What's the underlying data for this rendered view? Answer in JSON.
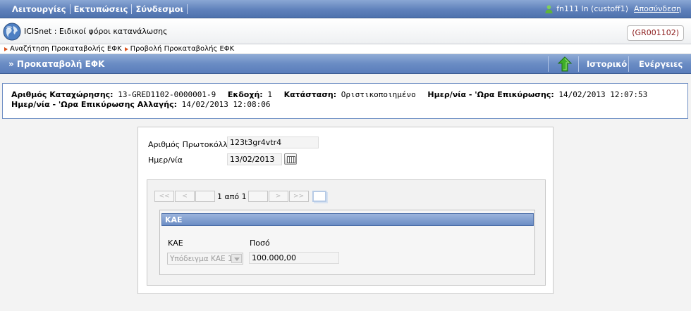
{
  "topbar": {
    "menu": [
      "Λειτουργίες",
      "Εκτυπώσεις",
      "Σύνδεσμοι"
    ],
    "user": "fn111 ln (custoff1)",
    "logout": "Αποσύνδεση"
  },
  "app": {
    "title": "ICISnet : Ειδικοί φόροι κατανάλωσης",
    "code": "(GR001102)"
  },
  "breadcrumbs": [
    "Αναζήτηση Προκαταβολής ΕΦΚ",
    "Προβολή Προκαταβολής ΕΦΚ"
  ],
  "titlebar": {
    "title": "» Προκαταβολή ΕΦΚ",
    "history": "Ιστορικό",
    "actions": "Ενέργειες"
  },
  "info": {
    "reg_label": "Αριθμός Καταχώρησης:",
    "reg_value": "13-GRED1102-0000001-9",
    "version_label": "Εκδοχή:",
    "version_value": "1",
    "status_label": "Κατάσταση:",
    "status_value": "Οριστικοποιημένο",
    "valid_label": "Ημερ/νία - 'Ωρα Επικύρωσης:",
    "valid_value": "14/02/2013 12:07:53",
    "change_label": "Ημερ/νία - 'Ωρα Επικύρωσης Αλλαγής:",
    "change_value": "14/02/2013 12:08:06"
  },
  "form": {
    "protocol_label": "Αριθμός Πρωτοκόλλου",
    "protocol_value": "123t3gr4vtr4",
    "date_label": "Ημερ/νία",
    "date_value": "13/02/2013"
  },
  "pager": {
    "first": "<<",
    "prev": "<",
    "text": "1 από 1",
    "next": ">",
    "last": ">>"
  },
  "kae": {
    "header": "ΚΑΕ",
    "col_kae": "ΚΑΕ",
    "col_amount": "Ποσό",
    "kae_value": "Υπόδειγμα ΚΑΕ 1",
    "amount_value": "100.000,00"
  }
}
